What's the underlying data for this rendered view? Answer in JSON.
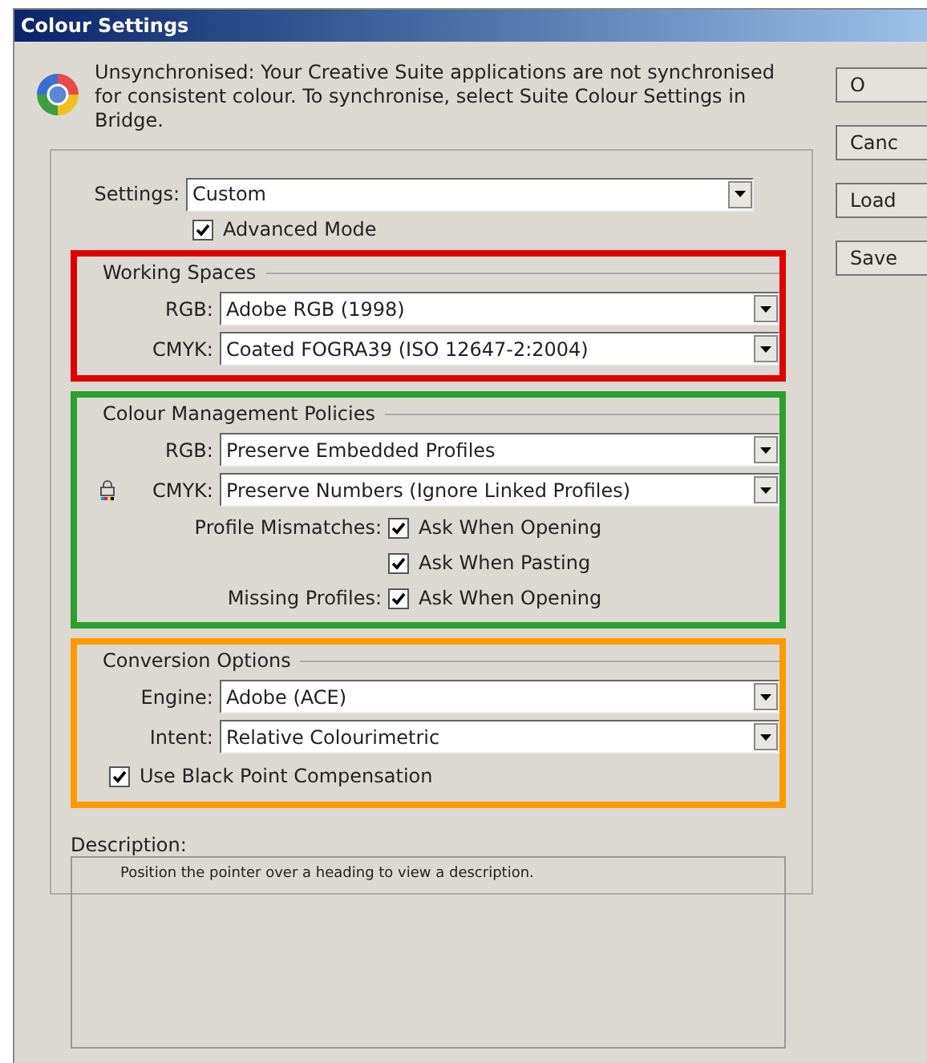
{
  "window": {
    "title": "Colour Settings"
  },
  "sync_message": "Unsynchronised: Your Creative Suite applications are not synchronised for consistent colour. To synchronise, select Suite Colour Settings in Bridge.",
  "settings": {
    "label": "Settings:",
    "value": "Custom"
  },
  "advanced_mode": {
    "label": "Advanced Mode",
    "checked": true
  },
  "sections": [
    {
      "title": "Working Spaces",
      "color": "#e00000",
      "rows": [
        {
          "kind": "select",
          "label": "RGB:",
          "value": "Adobe RGB (1998)"
        },
        {
          "kind": "select",
          "label": "CMYK:",
          "value": "Coated FOGRA39 (ISO 12647-2:2004)"
        }
      ]
    },
    {
      "title": "Colour Management Policies",
      "color": "#2ca02c",
      "rows": [
        {
          "kind": "select",
          "label": "RGB:",
          "value": "Preserve Embedded Profiles"
        },
        {
          "kind": "locked",
          "label": "CMYK:",
          "value": "Preserve Numbers (Ignore Linked Profiles)"
        },
        {
          "kind": "checkbox",
          "label": "Profile Mismatches:",
          "text": "Ask When Opening",
          "checked": true
        },
        {
          "kind": "checkbox",
          "text": "Ask When Pasting",
          "checked": true
        },
        {
          "kind": "checkbox",
          "label": "Missing Profiles:",
          "text": "Ask When Opening",
          "checked": true
        }
      ]
    },
    {
      "title": "Conversion Options",
      "color": "#ff9900",
      "rows": [
        {
          "kind": "select",
          "label": "Engine:",
          "value": "Adobe (ACE)"
        },
        {
          "kind": "select",
          "label": "Intent:",
          "value": "Relative Colourimetric"
        },
        {
          "kind": "option",
          "text": "Use Black Point Compensation",
          "checked": true
        }
      ]
    }
  ],
  "description": {
    "label": "Description:",
    "text": "Position the pointer over a heading to view a description."
  },
  "buttons": [
    {
      "label": "O"
    },
    {
      "label": "Canc"
    },
    {
      "label": "Load"
    },
    {
      "label": "Save"
    }
  ]
}
